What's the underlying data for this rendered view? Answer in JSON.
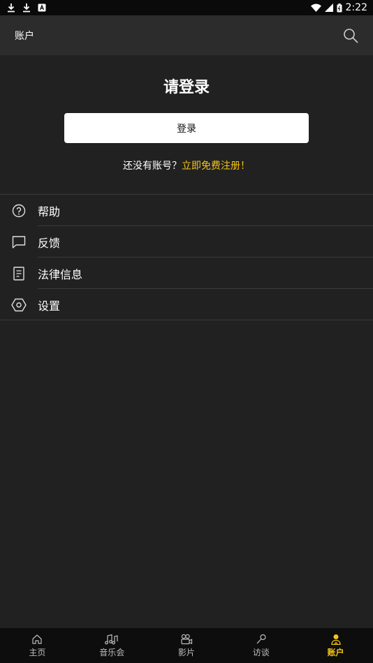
{
  "status_bar": {
    "time": "2:22"
  },
  "app_bar": {
    "title": "账户",
    "search_icon": "search-icon"
  },
  "login": {
    "heading": "请登录",
    "button_label": "登录",
    "register_prompt": "还没有账号？",
    "register_link": "立即免费注册！"
  },
  "menu": {
    "items": [
      {
        "label": "帮助",
        "icon": "help-icon"
      },
      {
        "label": "反馈",
        "icon": "feedback-icon"
      },
      {
        "label": "法律信息",
        "icon": "document-icon"
      },
      {
        "label": "设置",
        "icon": "settings-icon"
      }
    ]
  },
  "bottom_nav": {
    "items": [
      {
        "label": "主页",
        "icon": "home-icon"
      },
      {
        "label": "音乐会",
        "icon": "music-icon"
      },
      {
        "label": "影片",
        "icon": "movie-icon"
      },
      {
        "label": "访谈",
        "icon": "microphone-icon"
      },
      {
        "label": "账户",
        "icon": "account-icon",
        "active": true
      }
    ]
  },
  "colors": {
    "accent": "#f5c518",
    "background": "#212121",
    "app_bar": "#2c2c2c"
  }
}
